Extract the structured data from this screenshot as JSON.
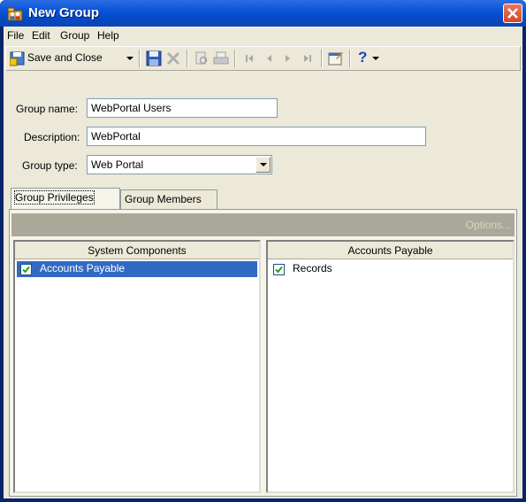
{
  "window": {
    "title": "New Group"
  },
  "menu": {
    "items": [
      "File",
      "Edit",
      "Group",
      "Help"
    ]
  },
  "toolbar": {
    "save_close_label": "Save and Close",
    "help_label": "?"
  },
  "form": {
    "group_name_label": "Group name:",
    "group_name_value": "WebPortal Users",
    "description_label": "Description:",
    "description_value": "WebPortal",
    "group_type_label": "Group type:",
    "group_type_value": "Web Portal"
  },
  "tabs": [
    {
      "label": "Group Privileges",
      "active": true
    },
    {
      "label": "Group Members",
      "active": false
    }
  ],
  "options_label": "Options...",
  "left_list": {
    "header": "System Components",
    "items": [
      {
        "label": "Accounts Payable",
        "checked": true,
        "selected": true
      }
    ]
  },
  "right_list": {
    "header": "Accounts Payable",
    "items": [
      {
        "label": "Records",
        "checked": true,
        "selected": false
      }
    ]
  },
  "colors": {
    "titlebar": "#0a54d8",
    "selection": "#316ac5",
    "check": "#21a121",
    "face": "#ece9d8"
  }
}
